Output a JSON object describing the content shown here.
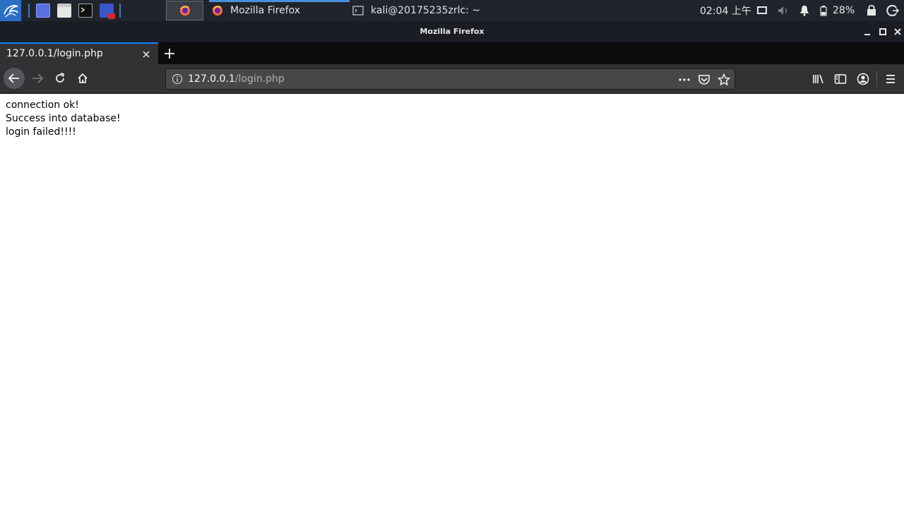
{
  "panel": {
    "tasks": [
      {
        "label": "Mozilla Firefox",
        "icon": "firefox-icon"
      },
      {
        "label": "kali@20175235zrlc: ~",
        "icon": "terminal-icon"
      }
    ],
    "clock": "02:04 上午",
    "battery": "28%",
    "accent": "#4a8fd9"
  },
  "window": {
    "title": "Mozilla Firefox"
  },
  "tabs": [
    {
      "label": "127.0.0.1/login.php"
    }
  ],
  "urlbar": {
    "host": "127.0.0.1",
    "path": "/login.php"
  },
  "page": {
    "lines": [
      "connection ok!",
      "Success into database!",
      "login failed!!!!"
    ]
  },
  "colors": {
    "tab_accent": "#0a84ff",
    "toolbar": "#323234"
  }
}
